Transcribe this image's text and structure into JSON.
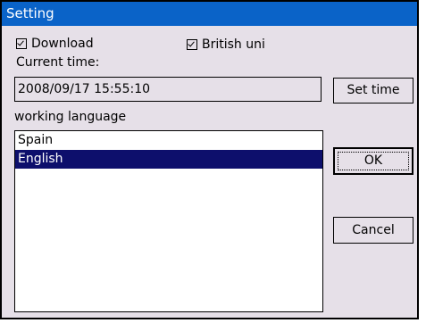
{
  "window": {
    "title": "Setting"
  },
  "download": {
    "label": "Download",
    "checked": true
  },
  "british_uni": {
    "label": "British uni",
    "checked": true
  },
  "time": {
    "label": "Current time:",
    "value": "2008/09/17 15:55:10",
    "set_button": "Set time"
  },
  "language": {
    "label": "working language",
    "items": [
      {
        "label": "Spain",
        "selected": false
      },
      {
        "label": "English",
        "selected": true
      }
    ]
  },
  "buttons": {
    "ok": "OK",
    "cancel": "Cancel"
  },
  "colors": {
    "title_bar": "#0a63c8",
    "selection": "#0d0f6c",
    "background": "#e6e0e8"
  }
}
